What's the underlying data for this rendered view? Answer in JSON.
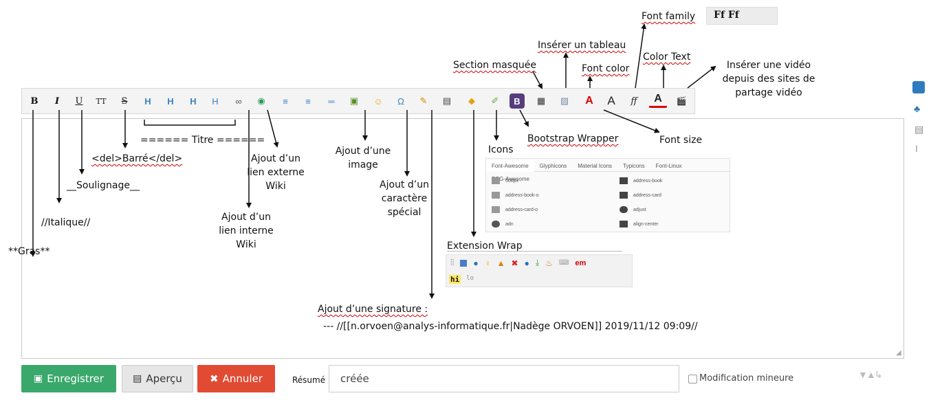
{
  "top_toolbar": {
    "font_family_label": "Font family",
    "font_family_glyphs": "Ff  Ff"
  },
  "toolbar_buttons": [
    {
      "id": "bold",
      "glyph": "B"
    },
    {
      "id": "italic",
      "glyph": "I"
    },
    {
      "id": "underline",
      "glyph": "U"
    },
    {
      "id": "monospace",
      "glyph": "TT"
    },
    {
      "id": "strike",
      "glyph": "S"
    },
    {
      "id": "h-same",
      "glyph": "H"
    },
    {
      "id": "h-lower",
      "glyph": "H"
    },
    {
      "id": "h-higher",
      "glyph": "H"
    },
    {
      "id": "h-select",
      "glyph": "H"
    },
    {
      "id": "internal-link",
      "glyph": "∞"
    },
    {
      "id": "external-link",
      "glyph": "◉"
    },
    {
      "id": "ordered-list",
      "glyph": "≡"
    },
    {
      "id": "unordered-list",
      "glyph": "≡"
    },
    {
      "id": "hr",
      "glyph": "═"
    },
    {
      "id": "image",
      "glyph": "▣"
    },
    {
      "id": "smiley",
      "glyph": "☺"
    },
    {
      "id": "special-char",
      "glyph": "Ω"
    },
    {
      "id": "signature",
      "glyph": "✎"
    },
    {
      "id": "hidden-section",
      "glyph": "▤"
    },
    {
      "id": "wrap",
      "glyph": "◆"
    },
    {
      "id": "icons",
      "glyph": "✐"
    },
    {
      "id": "bootstrap",
      "glyph": "B"
    },
    {
      "id": "table",
      "glyph": "▦"
    },
    {
      "id": "table2",
      "glyph": "▧"
    },
    {
      "id": "font-color",
      "glyph": "A"
    },
    {
      "id": "font-size",
      "glyph": "A"
    },
    {
      "id": "font-family",
      "glyph": "ff"
    },
    {
      "id": "color-text",
      "glyph": "A"
    },
    {
      "id": "video",
      "glyph": "🎬"
    }
  ],
  "annotations": {
    "section_masquee": "Section masquée",
    "inserer_tableau": "Insérer un tableau",
    "font_color": "Font color",
    "color_text": "Color Text",
    "inserer_video": "Insérer une vidéo depuis des sites de partage vidéo",
    "bootstrap_wrapper": "Bootstrap Wrapper",
    "font_size": "Font size",
    "titre": "====== Titre ======",
    "barre": "<del>Barré</del>",
    "soulignage": "__Soulignage__",
    "italique": "//Italique//",
    "gras": "**Gras**",
    "lien_externe": "Ajout d’un lien externe Wiki",
    "lien_interne": "Ajout d’un lien interne Wiki",
    "image": "Ajout d’une image",
    "caractere": "Ajout d’un caractère spécial",
    "icons": "Icons",
    "extension_wrap": "Extension Wrap",
    "signature_title": "Ajout d’une signature :",
    "signature_text": "--- //[[n.orvoen@analys-informatique.fr|Nadège ORVOEN]] 2019/11/12 09:09//"
  },
  "icons_panel": {
    "tabs": [
      "Font-Awesome",
      "Glyphicons",
      "Material Icons",
      "Typicons",
      "Font-Linux",
      "RPG-Awesome"
    ],
    "left_items": [
      "500px",
      "address-book-o",
      "address-card-o",
      "adn"
    ],
    "right_items": [
      "address-book",
      "address-card",
      "adjust",
      "align-center"
    ]
  },
  "wrap_panel": {
    "row2": [
      "hi",
      "lo"
    ],
    "em": "em"
  },
  "bottom_bar": {
    "save_label": "Enregistrer",
    "preview_label": "Aperçu",
    "cancel_label": "Annuler",
    "summary_label": "Résumé",
    "summary_value": "créée",
    "minor_label": "Modification mineure"
  },
  "colors": {
    "save": "#3aa86b",
    "cancel": "#e14a33",
    "preview": "#e6e6e6",
    "side_icon": "#2f7bbf"
  }
}
